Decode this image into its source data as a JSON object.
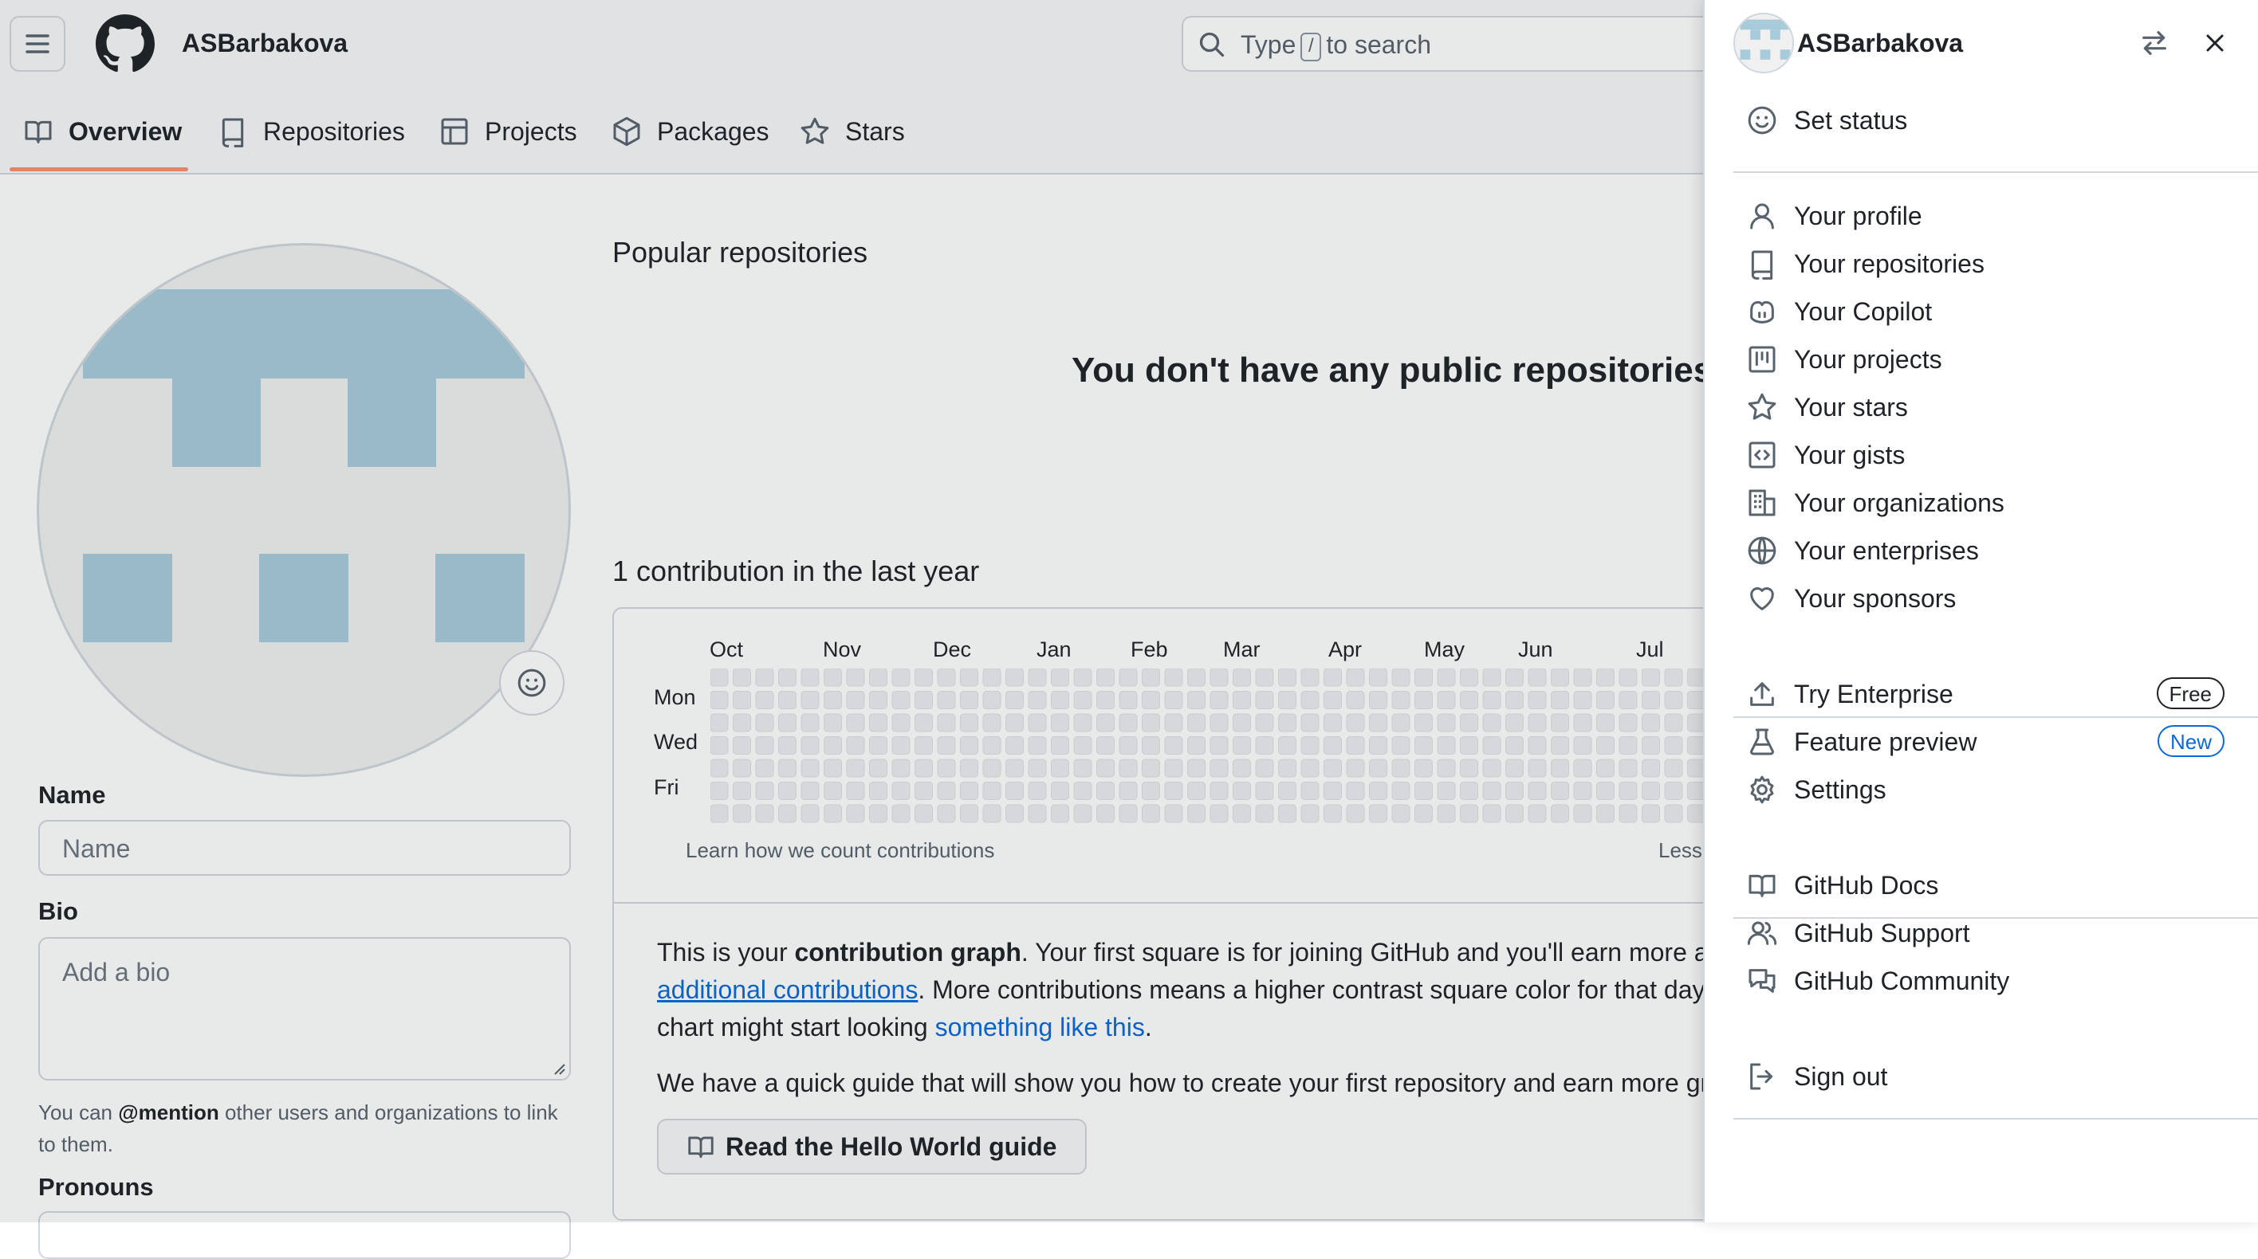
{
  "header": {
    "username": "ASBarbakova",
    "search": {
      "before": "Type",
      "key": "/",
      "after": "to search"
    }
  },
  "tabs": [
    {
      "label": "Overview",
      "icon": "book-icon",
      "active": true
    },
    {
      "label": "Repositories",
      "icon": "repo-icon"
    },
    {
      "label": "Projects",
      "icon": "table-icon"
    },
    {
      "label": "Packages",
      "icon": "package-icon"
    },
    {
      "label": "Stars",
      "icon": "star-icon"
    }
  ],
  "profile": {
    "name_label": "Name",
    "name_placeholder": "Name",
    "bio_label": "Bio",
    "bio_placeholder": "Add a bio",
    "hint_prefix": "You can",
    "hint_mention": "@mention",
    "hint_suffix": "other users and organizations to link to them.",
    "pronouns_label": "Pronouns"
  },
  "main": {
    "popular_title": "Popular repositories",
    "empty_message": "You don't have any public repositories y",
    "contrib_title": "1 contribution in the last year",
    "months": [
      "Oct",
      "Nov",
      "Dec",
      "Jan",
      "Feb",
      "Mar",
      "Apr",
      "May",
      "Jun",
      "Jul"
    ],
    "days": [
      "Mon",
      "Wed",
      "Fri"
    ],
    "learn_link": "Learn how we count contributions",
    "less_label": "Less",
    "para1_a": "This is your ",
    "para1_b": "contribution graph",
    "para1_c": ". Your first square is for joining GitHub and you'll earn more as y",
    "para2_link": "additional contributions",
    "para2_rest": ". More contributions means a higher contrast square color for that day.",
    "para3_a": "chart might start looking ",
    "para3_link": "something like this",
    "para3_b": ".",
    "para4": "We have a quick guide that will show you how to create your first repository and earn more gre",
    "guide_button": "Read the Hello World guide"
  },
  "drawer": {
    "username": "ASBarbakova",
    "items": [
      {
        "label": "Set status",
        "icon": "smiley-icon"
      },
      {
        "label": "Your profile",
        "icon": "person-icon"
      },
      {
        "label": "Your repositories",
        "icon": "repo-icon"
      },
      {
        "label": "Your Copilot",
        "icon": "copilot-icon"
      },
      {
        "label": "Your projects",
        "icon": "project-icon"
      },
      {
        "label": "Your stars",
        "icon": "star-icon"
      },
      {
        "label": "Your gists",
        "icon": "code-square-icon"
      },
      {
        "label": "Your organizations",
        "icon": "organization-icon"
      },
      {
        "label": "Your enterprises",
        "icon": "globe-icon"
      },
      {
        "label": "Your sponsors",
        "icon": "heart-icon"
      },
      {
        "label": "Try Enterprise",
        "icon": "upload-icon",
        "badge": "Free"
      },
      {
        "label": "Feature preview",
        "icon": "beaker-icon",
        "badge": "New"
      },
      {
        "label": "Settings",
        "icon": "gear-icon"
      },
      {
        "label": "GitHub Docs",
        "icon": "book-icon"
      },
      {
        "label": "GitHub Support",
        "icon": "people-icon"
      },
      {
        "label": "GitHub Community",
        "icon": "comment-discussion-icon"
      },
      {
        "label": "Sign out",
        "icon": "sign-out-icon"
      }
    ]
  },
  "colors": {
    "accent_underline": "#fd8c73",
    "link": "#0969da",
    "identicon": "#a8cbdc",
    "empty_cell": "#ebedf0"
  }
}
